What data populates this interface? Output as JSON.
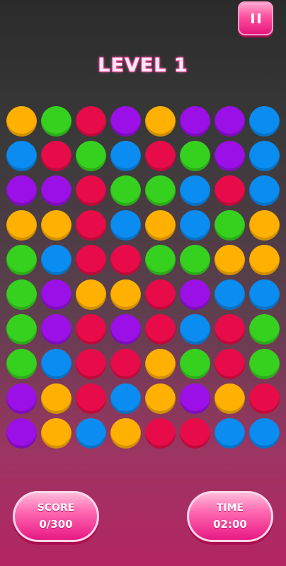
{
  "header": {
    "level_title": "LEVEL 1",
    "pause_icon": "pause-icon"
  },
  "board": {
    "columns": 8,
    "rows": [
      [
        "yellow",
        "green",
        "red",
        "purple",
        "yellow",
        "purple",
        "purple",
        "blue"
      ],
      [
        "blue",
        "red",
        "green",
        "blue",
        "red",
        "green",
        "purple",
        "blue"
      ],
      [
        "purple",
        "purple",
        "red",
        "green",
        "green",
        "blue",
        "red",
        "blue"
      ],
      [
        "yellow",
        "yellow",
        "red",
        "blue",
        "yellow",
        "blue",
        "green",
        "yellow"
      ],
      [
        "green",
        "blue",
        "red",
        "red",
        "green",
        "green",
        "yellow",
        "yellow"
      ],
      [
        "green",
        "purple",
        "yellow",
        "yellow",
        "red",
        "purple",
        "blue",
        "blue"
      ],
      [
        "green",
        "purple",
        "red",
        "purple",
        "red",
        "blue",
        "red",
        "green"
      ],
      [
        "green",
        "blue",
        "red",
        "red",
        "yellow",
        "green",
        "red",
        "green"
      ],
      [
        "purple",
        "yellow",
        "red",
        "blue",
        "yellow",
        "purple",
        "yellow",
        "red"
      ],
      [
        "purple",
        "yellow",
        "blue",
        "yellow",
        "red",
        "red",
        "blue",
        "blue"
      ]
    ],
    "colors": {
      "yellow": "#ffb000",
      "green": "#36d11f",
      "red": "#e80b49",
      "purple": "#9a10e6",
      "blue": "#0a8cf0"
    }
  },
  "footer": {
    "score_label": "SCORE",
    "score_value": "0/300",
    "time_label": "TIME",
    "time_value": "02:00"
  }
}
